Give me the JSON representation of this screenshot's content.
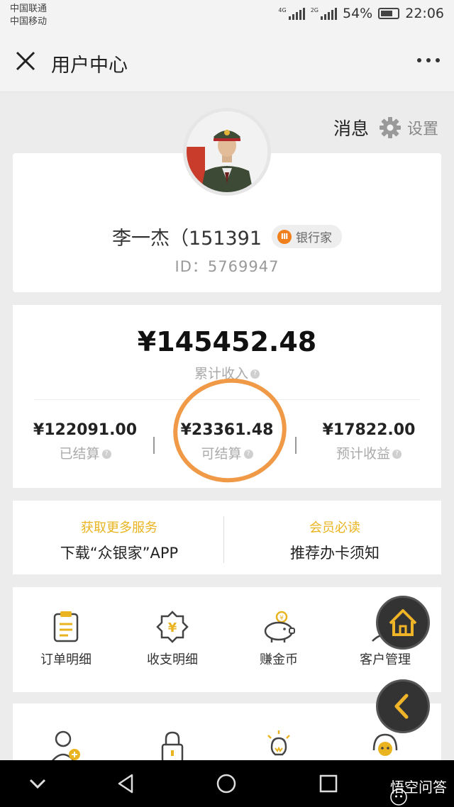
{
  "status_bar": {
    "carrier_1": "中国联通",
    "carrier_2": "中国移动",
    "network_1": "4G",
    "network_2": "2G",
    "battery": "54%",
    "time": "22:06"
  },
  "nav": {
    "title": "用户中心",
    "close_icon": "close-icon",
    "more_icon": "more-icon"
  },
  "top_links": {
    "messages": "消息",
    "settings": "设置"
  },
  "profile": {
    "name": "李一杰（151391",
    "level_badge": "银行家",
    "level_icon_text": "Ⅲ",
    "id_text": "ID：5769947"
  },
  "income": {
    "total": "¥145452.48",
    "total_label": "累计收入",
    "stats": [
      {
        "amount": "¥122091.00",
        "label": "已结算"
      },
      {
        "amount": "¥23361.48",
        "label": "可结算"
      },
      {
        "amount": "¥17822.00",
        "label": "预计收益"
      }
    ]
  },
  "promos": [
    {
      "highlight": "获取更多服务",
      "text": "下载“众银家”APP"
    },
    {
      "highlight": "会员必读",
      "text": "推荐办卡须知"
    }
  ],
  "menu": [
    {
      "label": "订单明细",
      "icon": "clipboard-icon"
    },
    {
      "label": "收支明细",
      "icon": "yen-badge-icon"
    },
    {
      "label": "赚金币",
      "icon": "piggy-bank-icon"
    },
    {
      "label": "客户管理",
      "icon": "customer-icon"
    }
  ],
  "menu_row2": [
    {
      "icon": "add-user-icon"
    },
    {
      "icon": "lock-icon"
    },
    {
      "icon": "lightbulb-icon"
    },
    {
      "icon": "headset-icon"
    }
  ],
  "fab": {
    "home_icon": "home-icon",
    "back_icon": "chevron-left-icon"
  },
  "system_nav": {
    "watermark": "悟空问答"
  },
  "colors": {
    "accent_yellow": "#e9b420",
    "circle_orange": "#f09a48",
    "badge_orange": "#f07f1c",
    "background": "#ececec"
  }
}
